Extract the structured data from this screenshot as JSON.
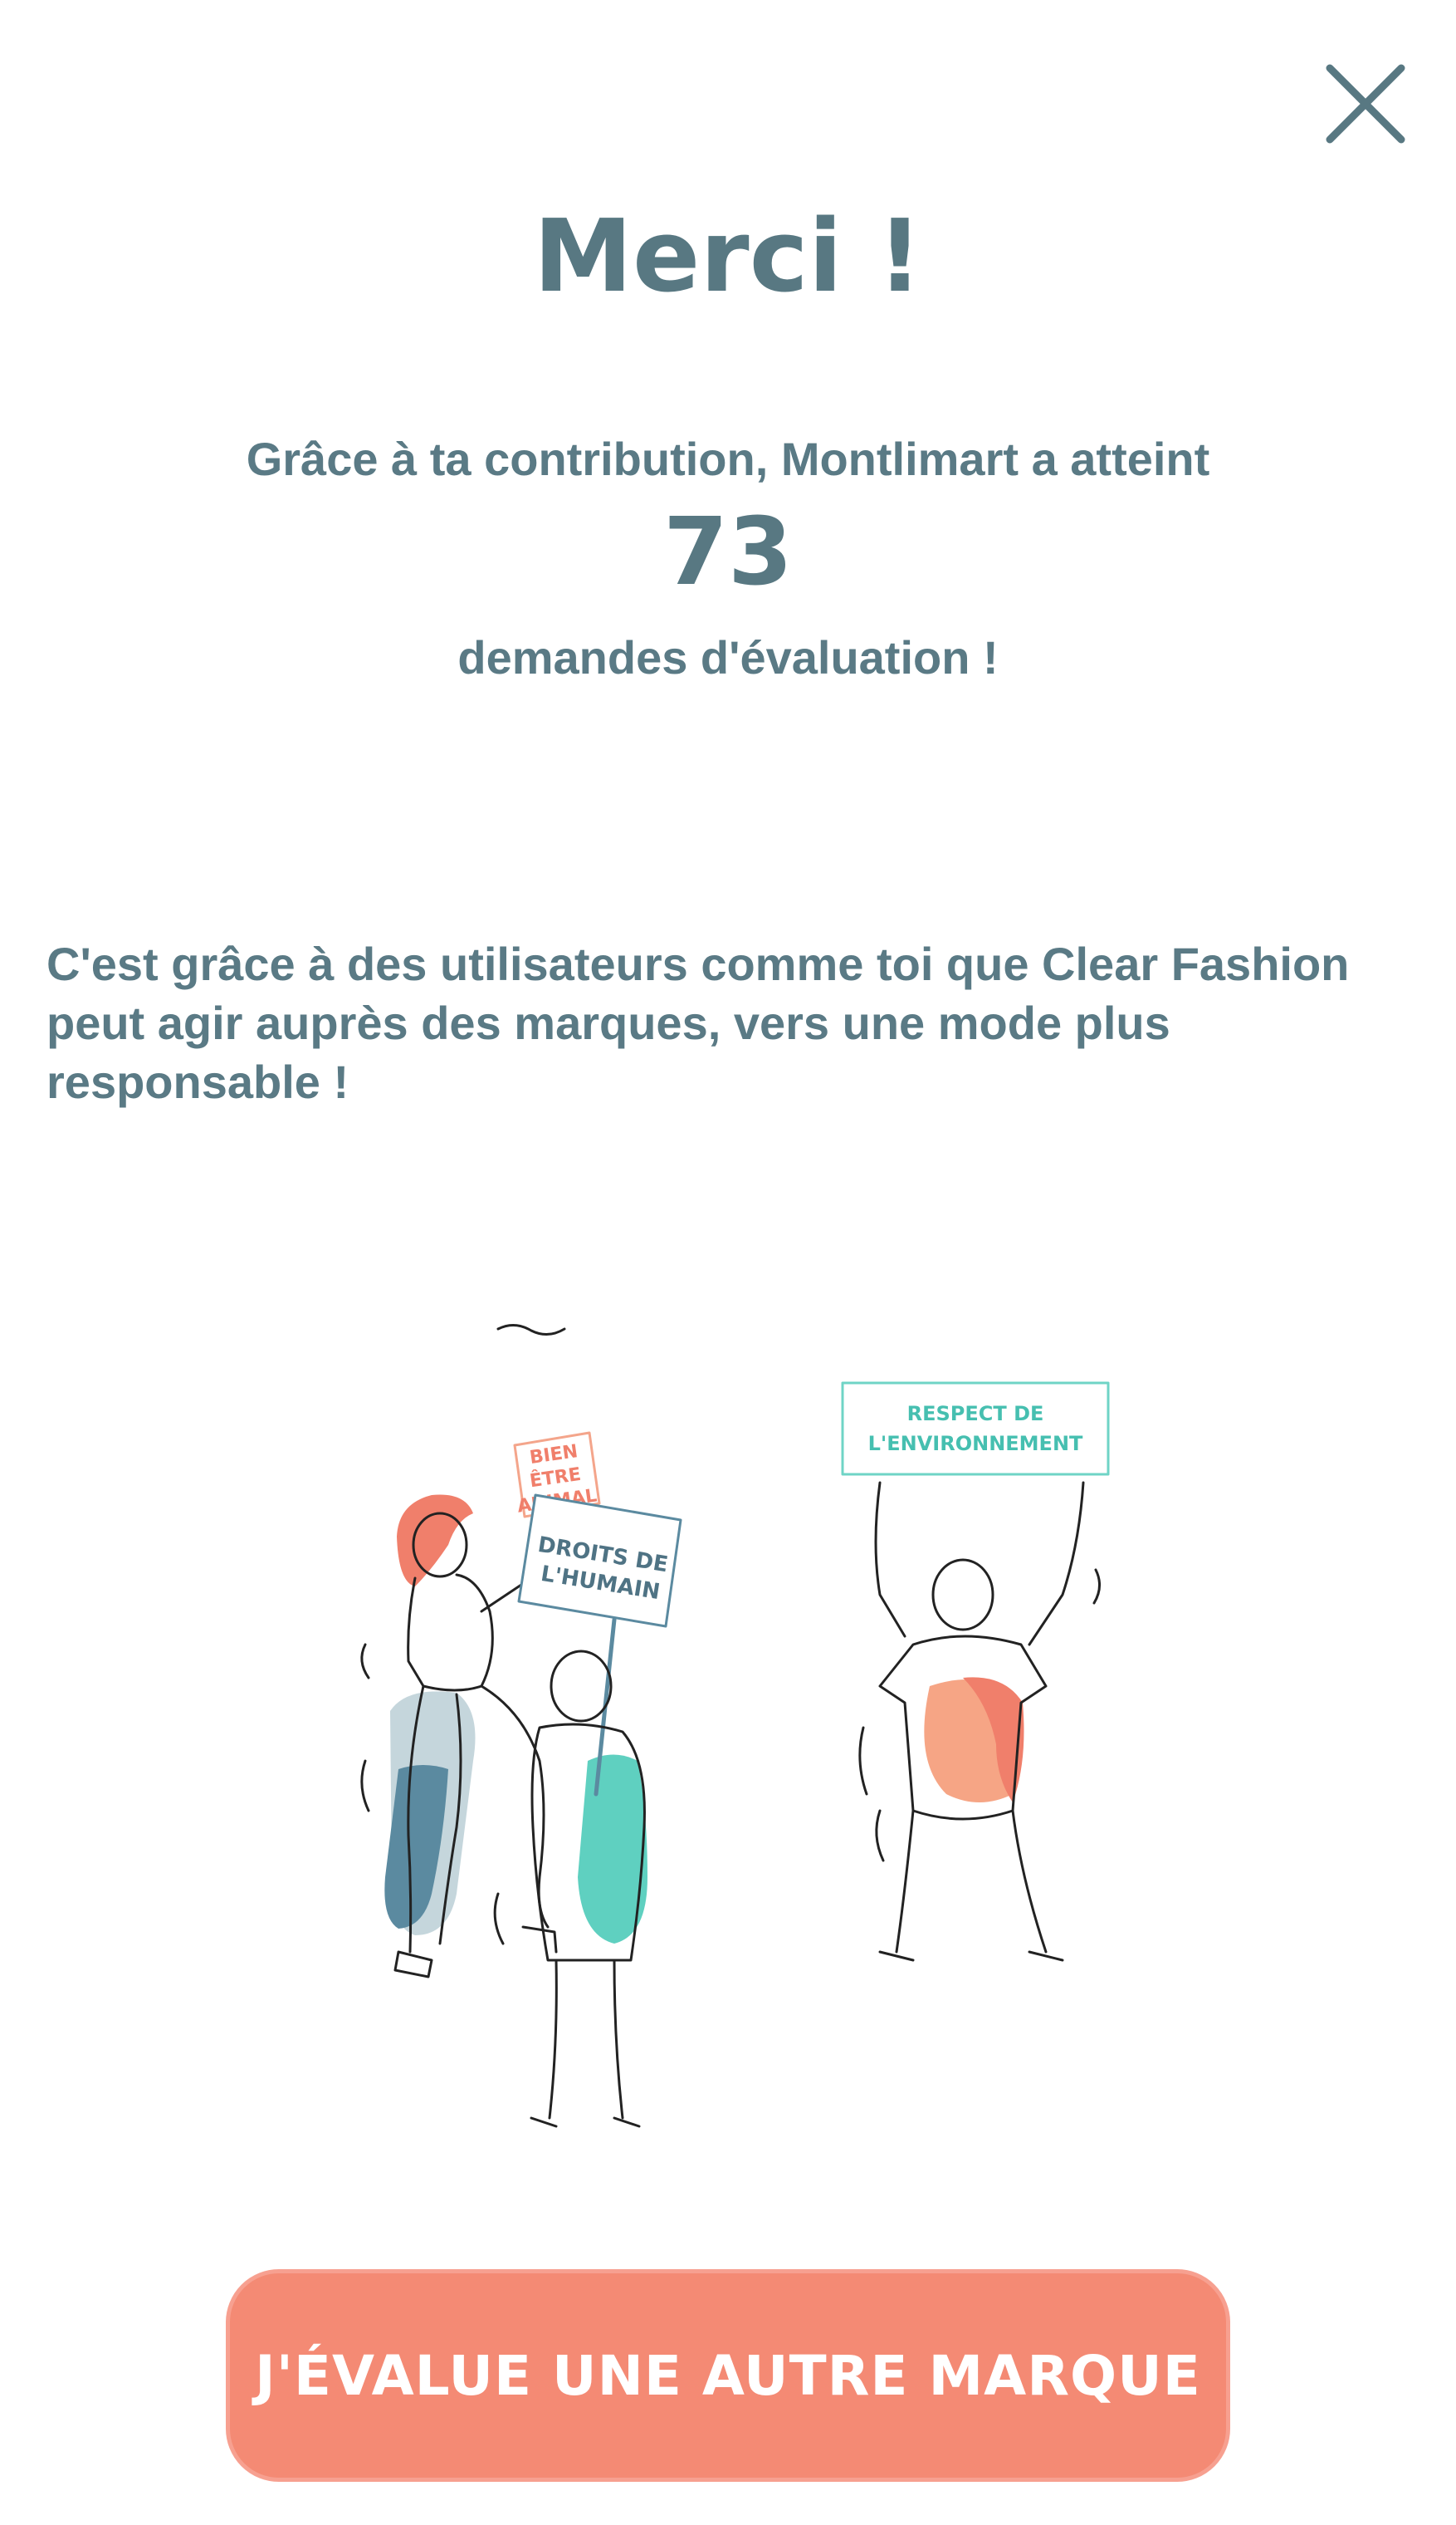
{
  "header": {
    "close_icon": "close-icon",
    "title": "Merci !"
  },
  "contribution": {
    "prefix": "Grâce à ta contribution, Montlimart a atteint",
    "count": "73",
    "suffix": "demandes d'évaluation !"
  },
  "message": "C'est grâce à des utilisateurs comme toi que Clear Fashion peut agir auprès des marques, vers une mode plus responsable !",
  "illustration": {
    "sign_animal_line1": "BIEN",
    "sign_animal_line2": "ÊTRE",
    "sign_animal_line3": "ANIMAL",
    "sign_env_line1": "RESPECT DE",
    "sign_env_line2": "L'ENVIRONNEMENT",
    "sign_human_line1": "DROITS DE",
    "sign_human_line2": "L'HUMAIN"
  },
  "cta": {
    "label": "J'ÉVALUE UNE AUTRE MARQUE"
  },
  "colors": {
    "text": "#5a7a85",
    "accent": "#f48a74",
    "teal": "#5fd0c0",
    "blue": "#5b8aa0",
    "peach": "#f6a585"
  }
}
